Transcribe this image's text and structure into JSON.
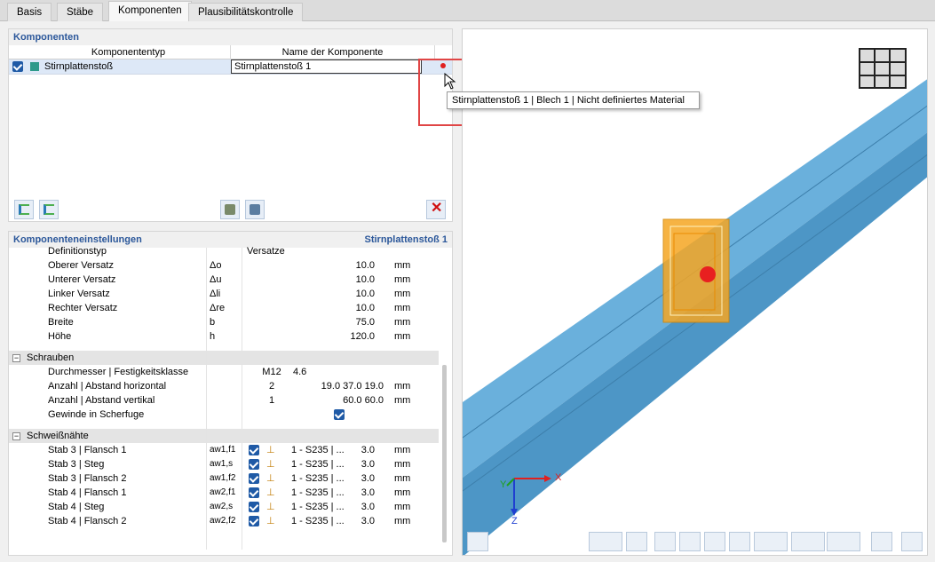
{
  "tabs": [
    "Basis",
    "Stäbe",
    "Komponenten",
    "Plausibilitätskontrolle"
  ],
  "components": {
    "title": "Komponenten",
    "col_type": "Komponententyp",
    "col_name": "Name der Komponente",
    "row": {
      "type": "Stirnplattenstoß",
      "name": "Stirnplattenstoß 1",
      "checked": true
    },
    "tooltip": "Stirnplattenstoß 1 | Blech 1 | Nicht definiertes Material",
    "accent": "#2e9a8a"
  },
  "settings": {
    "title": "Komponenteneinstellungen",
    "subtitle": "Stirnplattenstoß 1",
    "plate_rows": [
      {
        "name": "Definitionstyp",
        "sym": "",
        "val": "Versatze",
        "unit": ""
      },
      {
        "name": "Oberer Versatz",
        "sym": "Δo",
        "val": "10.0",
        "unit": "mm"
      },
      {
        "name": "Unterer Versatz",
        "sym": "Δu",
        "val": "10.0",
        "unit": "mm"
      },
      {
        "name": "Linker Versatz",
        "sym": "Δli",
        "val": "10.0",
        "unit": "mm"
      },
      {
        "name": "Rechter Versatz",
        "sym": "Δre",
        "val": "10.0",
        "unit": "mm"
      },
      {
        "name": "Breite",
        "sym": "b",
        "val": "75.0",
        "unit": "mm"
      },
      {
        "name": "Höhe",
        "sym": "h",
        "val": "120.0",
        "unit": "mm"
      }
    ],
    "bolts_title": "Schrauben",
    "bolts": [
      {
        "name": "Durchmesser | Festigkeitsklasse",
        "a": "M12",
        "b": "4.6",
        "unit": ""
      },
      {
        "name": "Anzahl | Abstand horizontal",
        "a": "2",
        "b": "19.0 37.0 19.0",
        "unit": "mm"
      },
      {
        "name": "Anzahl | Abstand vertikal",
        "a": "1",
        "b": "60.0 60.0",
        "unit": "mm"
      },
      {
        "name": "Gewinde in Scherfuge",
        "a": "",
        "b": "",
        "unit": "",
        "check": true
      }
    ],
    "welds_title": "Schweißnähte",
    "welds": [
      {
        "name": "Stab 3 | Flansch 1",
        "sym": "aw1,f1",
        "mat": "1 - S235 | ...",
        "val": "3.0",
        "unit": "mm"
      },
      {
        "name": "Stab 3 | Steg",
        "sym": "aw1,s",
        "mat": "1 - S235 | ...",
        "val": "3.0",
        "unit": "mm"
      },
      {
        "name": "Stab 3 | Flansch 2",
        "sym": "aw1,f2",
        "mat": "1 - S235 | ...",
        "val": "3.0",
        "unit": "mm"
      },
      {
        "name": "Stab 4 | Flansch 1",
        "sym": "aw2,f1",
        "mat": "1 - S235 | ...",
        "val": "3.0",
        "unit": "mm"
      },
      {
        "name": "Stab 4 | Steg",
        "sym": "aw2,s",
        "mat": "1 - S235 | ...",
        "val": "3.0",
        "unit": "mm"
      },
      {
        "name": "Stab 4 | Flansch 2",
        "sym": "aw2,f2",
        "mat": "1 - S235 | ...",
        "val": "3.0",
        "unit": "mm"
      }
    ]
  },
  "view": {
    "axis_x": "X",
    "axis_y": "Y",
    "axis_z": "Z",
    "beam_color": "#6ab0dc",
    "plate_color": "#f5a623"
  }
}
